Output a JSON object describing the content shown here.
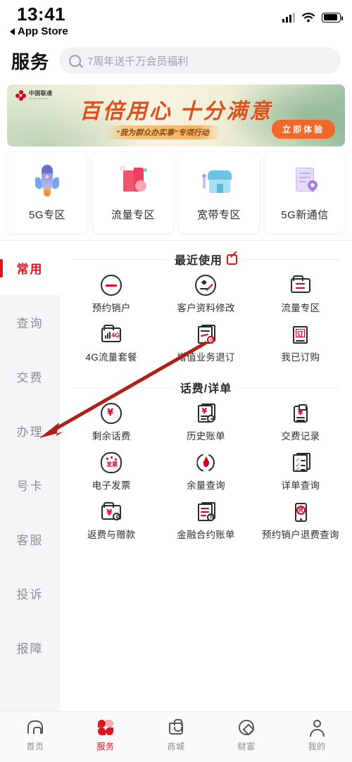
{
  "status_bar": {
    "time": "13:41",
    "back_label": "App Store",
    "signal_icon": "cellular-signal-icon",
    "wifi_icon": "wifi-icon",
    "battery_icon": "battery-icon"
  },
  "header": {
    "title": "服务",
    "search_placeholder": "7周年送千万会员福利",
    "search_icon": "search-icon"
  },
  "banner": {
    "brand": "中国联通",
    "brand_sub": "China unicom",
    "title": "百倍用心 十分满意",
    "subtitle": "“我为群众办实事”专项行动",
    "button": "立即体验"
  },
  "category_cards": [
    {
      "label": "5G专区",
      "icon": "rocket-icon"
    },
    {
      "label": "流量专区",
      "icon": "data-package-icon"
    },
    {
      "label": "宽带专区",
      "icon": "broadband-shop-icon"
    },
    {
      "label": "5G新通信",
      "icon": "new-communication-icon"
    }
  ],
  "sidebar": {
    "items": [
      {
        "label": "常用",
        "active": true
      },
      {
        "label": "查询",
        "active": false
      },
      {
        "label": "交费",
        "active": false
      },
      {
        "label": "办理",
        "active": false
      },
      {
        "label": "号卡",
        "active": false
      },
      {
        "label": "客服",
        "active": false
      },
      {
        "label": "投诉",
        "active": false
      },
      {
        "label": "报障",
        "active": false
      }
    ]
  },
  "sections": [
    {
      "title": "最近使用",
      "edit_icon": "edit-icon",
      "items": [
        {
          "label": "预约销户",
          "icon": "circle-minus-icon"
        },
        {
          "label": "客户资料修改",
          "icon": "person-edit-icon"
        },
        {
          "label": "流量专区",
          "icon": "folder-swap-icon"
        },
        {
          "label": "4G流量套餐",
          "icon": "folder-4g-icon"
        },
        {
          "label": "增值业务退订",
          "icon": "document-refund-icon"
        },
        {
          "label": "我已订购",
          "icon": "subscription-icon"
        }
      ]
    },
    {
      "title": "话费/详单",
      "items": [
        {
          "label": "剩余话费",
          "icon": "circle-yen-icon"
        },
        {
          "label": "历史账单",
          "icon": "bill-history-icon"
        },
        {
          "label": "交费记录",
          "icon": "clipboard-yen-icon"
        },
        {
          "label": "电子发票",
          "icon": "invoice-icon"
        },
        {
          "label": "余量查询",
          "icon": "balance-drop-icon"
        },
        {
          "label": "详单查询",
          "icon": "checklist-icon"
        },
        {
          "label": "返费与赠款",
          "icon": "folder-yen-icon"
        },
        {
          "label": "金融合约账单",
          "icon": "finance-contract-icon"
        },
        {
          "label": "预约销户退费查询",
          "icon": "phone-refund-icon"
        }
      ]
    }
  ],
  "tabbar": {
    "items": [
      {
        "label": "首页",
        "icon": "home-icon",
        "active": false
      },
      {
        "label": "服务",
        "icon": "service-flower-icon",
        "active": true
      },
      {
        "label": "商城",
        "icon": "shop-bag-icon",
        "active": false
      },
      {
        "label": "财富",
        "icon": "wealth-coin-icon",
        "active": false
      },
      {
        "label": "我的",
        "icon": "user-icon",
        "active": false
      }
    ]
  },
  "annotation": {
    "type": "arrow",
    "color": "#b01f18",
    "points_at": "办理"
  },
  "colors": {
    "brand_red": "#e1131d",
    "accent_red": "#d1001f",
    "icon_dark": "#2b2b2b",
    "muted": "#8e8e93",
    "page_bg": "#f5f5f7"
  }
}
